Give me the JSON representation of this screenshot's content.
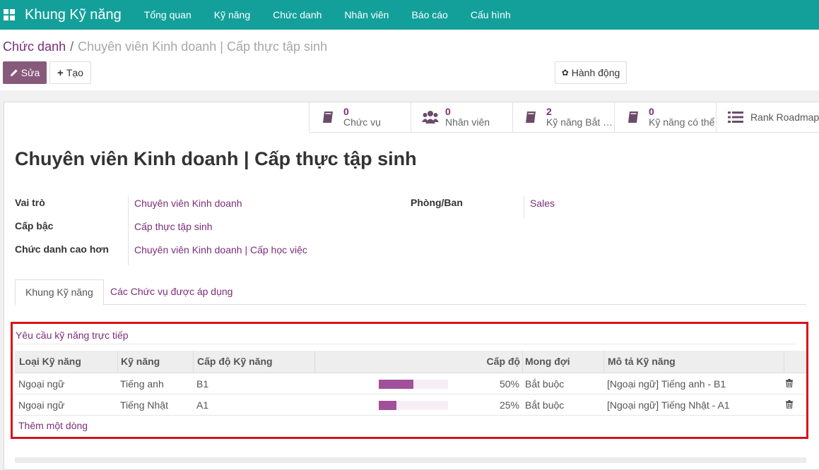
{
  "navbar": {
    "brand": "Khung Kỹ năng",
    "items": [
      "Tổng quan",
      "Kỹ năng",
      "Chức danh",
      "Nhân viên",
      "Báo cáo",
      "Cấu hình"
    ]
  },
  "breadcrumb": {
    "parent": "Chức danh",
    "current": "Chuyên viên Kinh doanh | Cấp thực tập sinh"
  },
  "buttons": {
    "edit": "Sửa",
    "create": "Tạo",
    "action": "Hành động"
  },
  "stats": [
    {
      "icon": "book-icon",
      "value": "0",
      "label": "Chức vụ"
    },
    {
      "icon": "users-icon",
      "value": "0",
      "label": "Nhân viên"
    },
    {
      "icon": "book-icon",
      "value": "2",
      "label": "Kỹ năng Bắt buộc"
    },
    {
      "icon": "book-icon",
      "value": "0",
      "label": "Kỹ năng có thể"
    },
    {
      "icon": "list-icon",
      "value": "",
      "label": "Rank Roadmap"
    }
  ],
  "record": {
    "title": "Chuyên viên Kinh doanh | Cấp thực tập sinh",
    "fields": {
      "role_label": "Vai trò",
      "role_value": "Chuyên viên Kinh doanh",
      "grade_label": "Cấp bậc",
      "grade_value": "Cấp thực tập sinh",
      "higher_label": "Chức danh cao hơn",
      "higher_value": "Chuyên viên Kinh doanh | Cấp học việc",
      "dept_label": "Phòng/Ban",
      "dept_value": "Sales"
    }
  },
  "tabs": [
    "Khung Kỹ năng",
    "Các Chức vụ được áp dụng"
  ],
  "section": {
    "title": "Yêu cầu kỹ năng trực tiếp",
    "columns": [
      "Loại Kỹ năng",
      "Kỹ năng",
      "Cấp độ Kỹ năng",
      "Cấp độ",
      "Mong đợi",
      "Mô tả Kỹ năng"
    ],
    "rows": [
      {
        "type": "Ngoại ngữ",
        "skill": "Tiếng anh",
        "level": "B1",
        "progress": 50,
        "progress_label": "50%",
        "expect": "Bắt buộc",
        "desc": "[Ngoại ngữ] Tiếng anh - B1"
      },
      {
        "type": "Ngoại ngữ",
        "skill": "Tiếng Nhật",
        "level": "A1",
        "progress": 25,
        "progress_label": "25%",
        "expect": "Bắt buộc",
        "desc": "[Ngoại ngữ] Tiếng Nhật - A1"
      }
    ],
    "add_line": "Thêm một dòng"
  },
  "colors": {
    "navbar": "#13a09a",
    "primary": "#875a7b",
    "link": "#7c2d78",
    "bar_fill": "#a1509a",
    "highlight": "#d9121b"
  }
}
